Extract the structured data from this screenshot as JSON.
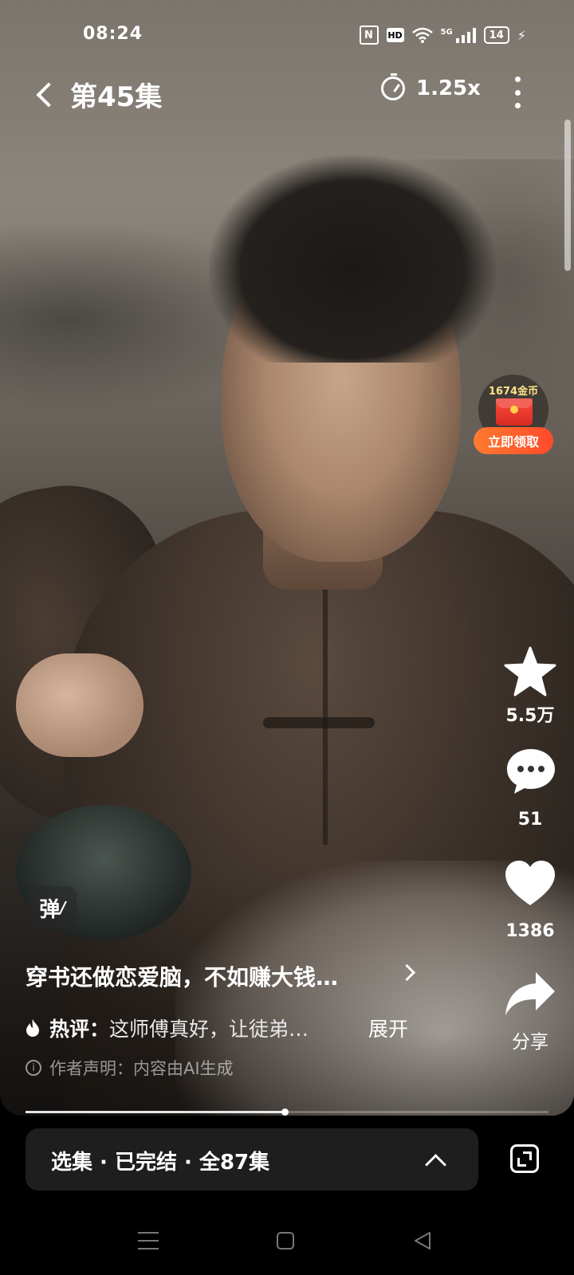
{
  "status_bar": {
    "time": "08:24",
    "nfc_label": "N",
    "hd_label": "HD",
    "network_label": "5G",
    "battery": "14"
  },
  "header": {
    "episode_title": "第45集",
    "speed": "1.25x"
  },
  "reward": {
    "coins": "1674金币",
    "claim_label": "立即领取"
  },
  "actions": {
    "favorite_count": "5.5万",
    "comment_count": "51",
    "like_count": "1386",
    "share_label": "分享"
  },
  "danmaku": {
    "label": "弹"
  },
  "caption": {
    "drama_title": "穿书还做恋爱脑，不如赚大钱…",
    "hot_label": "热评：",
    "hot_text": "这师傅真好，让徒弟…",
    "expand_label": "展开",
    "disclaimer": "作者声明：内容由AI生成"
  },
  "playback": {
    "progress_fraction": 0.495
  },
  "episode_bar": {
    "label": "选集 · 已完结 · 全87集"
  },
  "colors": {
    "accent_orange": "#ff5a2b",
    "coin_gold": "#ffe28a"
  }
}
